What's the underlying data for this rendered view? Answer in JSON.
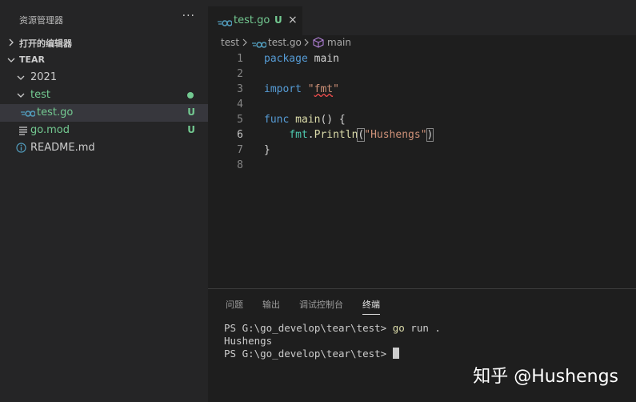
{
  "sidebar": {
    "title": "资源管理器",
    "more": "···",
    "open_editors": "打开的编辑器",
    "project": "TEAR",
    "tree": [
      {
        "label": "2021"
      },
      {
        "label": "test"
      },
      {
        "label": "test.go",
        "badge": "U"
      },
      {
        "label": "go.mod",
        "badge": "U"
      },
      {
        "label": "README.md"
      }
    ]
  },
  "tab": {
    "label": "test.go",
    "status": "U",
    "close": "×"
  },
  "breadcrumb": [
    "test",
    "test.go",
    "main"
  ],
  "editor": {
    "line_numbers": [
      "1",
      "2",
      "3",
      "4",
      "5",
      "6",
      "7",
      "8"
    ],
    "active_line": 6,
    "code": {
      "l1_kw": "package",
      "l1_rest": " main",
      "l3_kw": "import",
      "l3_q1": " \"",
      "l3_str": "fmt",
      "l3_q2": "\"",
      "l5_kw": "func",
      "l5_fn": " main",
      "l5_rest": "() {",
      "l6_indent": "    ",
      "l6_pkg": "fmt",
      "l6_dot": ".",
      "l6_fn": "Println",
      "l6_open": "(",
      "l6_str": "\"Hushengs\"",
      "l6_close": ")",
      "l7": "}"
    }
  },
  "panel": {
    "tabs": [
      "问题",
      "输出",
      "调试控制台",
      "终端"
    ],
    "active_tab": "终端",
    "terminal": {
      "line1_prompt": "PS G:\\go_develop\\tear\\test> ",
      "line1_cmd": "go",
      "line1_rest": " run .",
      "line2": "Hushengs",
      "line3_prompt": "PS G:\\go_develop\\tear\\test> "
    }
  },
  "watermark": "知乎 @Hushengs",
  "colors": {
    "untracked": "#73c991",
    "keyword": "#569cd6",
    "string": "#ce9178",
    "function": "#dcdcaa"
  }
}
